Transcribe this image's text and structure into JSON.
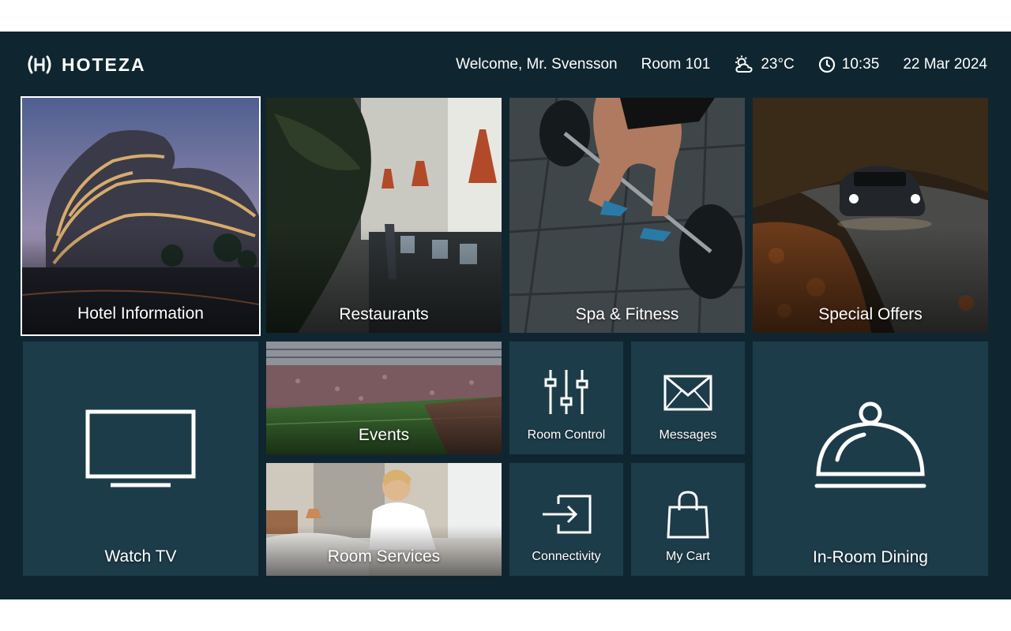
{
  "header": {
    "brand": "HOTEZA",
    "welcome": "Welcome, Mr. Svensson",
    "room": "Room 101",
    "weather": {
      "icon": "partly-cloudy-icon",
      "temperature": "23°C"
    },
    "time": {
      "icon": "clock-icon",
      "value": "10:35"
    },
    "date": "22 Mar 2024"
  },
  "tiles": {
    "hotel_information": {
      "label": "Hotel Information",
      "selected": true
    },
    "restaurants": {
      "label": "Restaurants"
    },
    "spa_fitness": {
      "label": "Spa & Fitness"
    },
    "special_offers": {
      "label": "Special Offers"
    },
    "watch_tv": {
      "label": "Watch TV",
      "icon": "tv-icon"
    },
    "events": {
      "label": "Events"
    },
    "room_control": {
      "label": "Room Control",
      "icon": "sliders-icon"
    },
    "messages": {
      "label": "Messages",
      "icon": "envelope-icon"
    },
    "in_room_dining": {
      "label": "In-Room Dining",
      "icon": "cloche-icon"
    },
    "room_services": {
      "label": "Room Services"
    },
    "connectivity": {
      "label": "Connectivity",
      "icon": "input-arrow-icon"
    },
    "my_cart": {
      "label": "My Cart",
      "icon": "shopping-bag-icon"
    }
  },
  "colors": {
    "background": "#0f2630",
    "tile": "#1d3c4a",
    "text": "#ffffff"
  }
}
